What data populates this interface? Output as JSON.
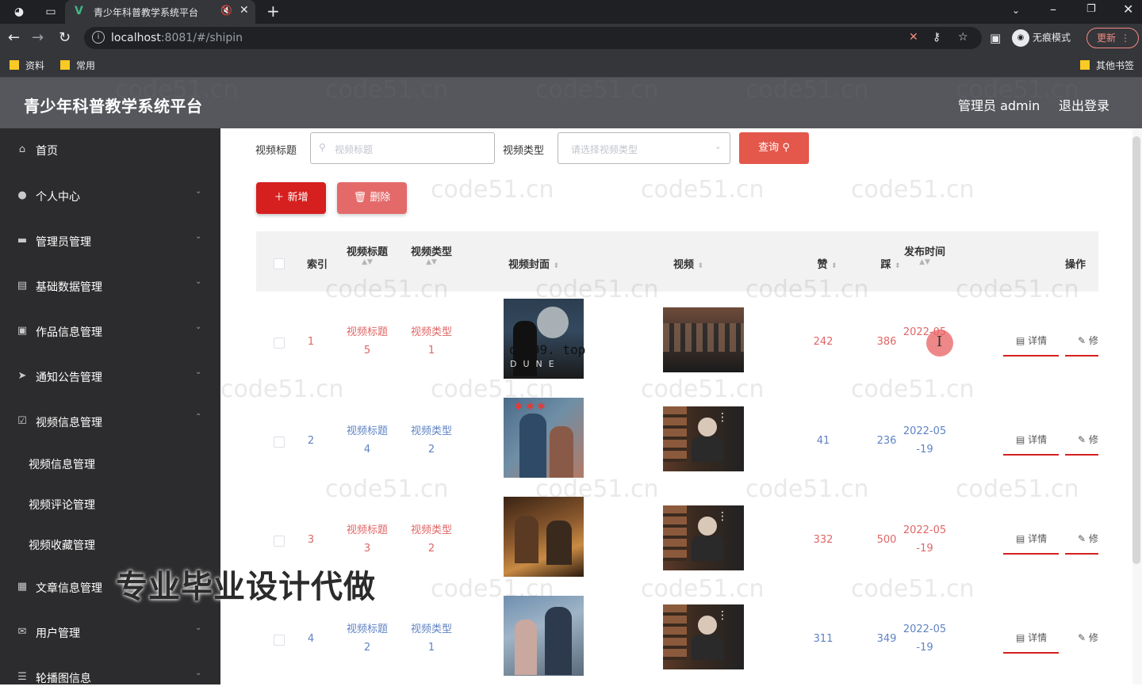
{
  "browser": {
    "tab_title": "青少年科普教学系统平台",
    "url_host": "localhost",
    "url_rest": ":8081/#/shipin",
    "incognito_label": "无痕模式",
    "update_label": "更新",
    "bookmarks": [
      "资料",
      "常用"
    ],
    "other_bookmarks": "其他书签"
  },
  "header": {
    "brand": "青少年科普教学系统平台",
    "user": "管理员 admin",
    "logout": "退出登录"
  },
  "sidebar": {
    "items": [
      {
        "label": "首页",
        "icon": "home-icon"
      },
      {
        "label": "个人中心",
        "icon": "user-icon"
      },
      {
        "label": "管理员管理",
        "icon": "briefcase-icon"
      },
      {
        "label": "基础数据管理",
        "icon": "database-icon"
      },
      {
        "label": "作品信息管理",
        "icon": "chat-icon"
      },
      {
        "label": "通知公告管理",
        "icon": "send-icon"
      },
      {
        "label": "视频信息管理",
        "icon": "checklist-icon"
      },
      {
        "label": "文章信息管理",
        "icon": "document-icon"
      },
      {
        "label": "用户管理",
        "icon": "mail-icon"
      },
      {
        "label": "轮播图信息",
        "icon": "sliders-icon"
      }
    ],
    "subitems": [
      "视频信息管理",
      "视频评论管理",
      "视频收藏管理"
    ]
  },
  "search": {
    "title_label": "视频标题",
    "title_placeholder": "视频标题",
    "type_label": "视频类型",
    "type_placeholder": "请选择视频类型",
    "query_button": "查询"
  },
  "actions": {
    "add_button": "新增",
    "delete_button": "删除"
  },
  "table": {
    "columns": {
      "index": "索引",
      "title": "视频标题",
      "type": "视频类型",
      "cover": "视频封面",
      "video": "视频",
      "likes": "赞",
      "dislikes": "踩",
      "published": "发布时间",
      "ops": "操作"
    },
    "detail_label": "详情",
    "edit_label": "修改",
    "rows": [
      {
        "index": "1",
        "title_a": "视频标题",
        "title_b": "5",
        "type_a": "视频类型",
        "type_b": "1",
        "likes": "242",
        "dislikes": "386",
        "date_a": "2022-05",
        "date_b": "",
        "color": "red"
      },
      {
        "index": "2",
        "title_a": "视频标题",
        "title_b": "4",
        "type_a": "视频类型",
        "type_b": "2",
        "likes": "41",
        "dislikes": "236",
        "date_a": "2022-05",
        "date_b": "-19",
        "color": "blue"
      },
      {
        "index": "3",
        "title_a": "视频标题",
        "title_b": "3",
        "type_a": "视频类型",
        "type_b": "2",
        "likes": "332",
        "dislikes": "500",
        "date_a": "2022-05",
        "date_b": "-19",
        "color": "red"
      },
      {
        "index": "4",
        "title_a": "视频标题",
        "title_b": "2",
        "type_a": "视频类型",
        "type_b": "1",
        "likes": "311",
        "dislikes": "349",
        "date_a": "2022-05",
        "date_b": "-19",
        "color": "blue"
      }
    ]
  },
  "overlays": {
    "watermark": "code51.cn",
    "ad_text": "专业毕业设计代做",
    "domain_text": "ode99. top"
  },
  "colors": {
    "primary_red": "#d61f1f",
    "sidebar_bg": "#2c2c2e",
    "header_bg": "#56575c"
  }
}
